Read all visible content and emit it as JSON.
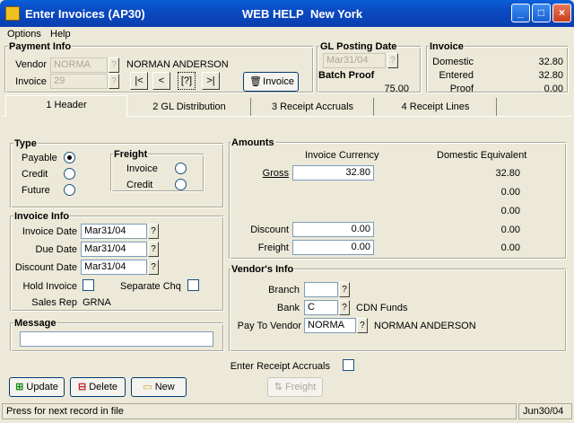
{
  "window": {
    "title": "Enter Invoices (AP30)",
    "web_help": "WEB HELP",
    "company": "New York"
  },
  "menu": [
    "Options",
    "Help"
  ],
  "payment_info": {
    "legend": "Payment Info",
    "vendor_label": "Vendor",
    "vendor_value": "NORMA",
    "vendor_name": "NORMAN ANDERSON",
    "invoice_label": "Invoice",
    "invoice_value": "29",
    "invoice_button": "Invoice",
    "nav": [
      "|<",
      "<",
      "[?]",
      ">|"
    ]
  },
  "gl_posting": {
    "legend": "GL Posting Date",
    "date": "Mar31/04",
    "batch_proof_label": "Batch Proof",
    "batch_proof_value": "75.00"
  },
  "invoice_summary": {
    "legend": "Invoice",
    "domestic_label": "Domestic",
    "domestic_value": "32.80",
    "entered_label": "Entered",
    "entered_value": "32.80",
    "proof_label": "Proof",
    "proof_value": "0.00"
  },
  "tabs": [
    "1 Header",
    "2 GL Distribution",
    "3 Receipt Accruals",
    "4 Receipt Lines"
  ],
  "type": {
    "legend": "Type",
    "options": [
      "Payable",
      "Credit",
      "Future"
    ],
    "selected": "Payable"
  },
  "freight": {
    "legend": "Freight",
    "options": [
      "Invoice",
      "Credit"
    ]
  },
  "invoice_info": {
    "legend": "Invoice Info",
    "invoice_date_label": "Invoice Date",
    "invoice_date": "Mar31/04",
    "due_date_label": "Due Date",
    "due_date": "Mar31/04",
    "discount_date_label": "Discount Date",
    "discount_date": "Mar31/04",
    "hold_invoice_label": "Hold Invoice",
    "separate_chq_label": "Separate Chq",
    "sales_rep_label": "Sales Rep",
    "sales_rep": "GRNA"
  },
  "message": {
    "legend": "Message",
    "value": ""
  },
  "amounts": {
    "legend": "Amounts",
    "col_invoice": "Invoice Currency",
    "col_domestic": "Domestic Equivalent",
    "gross_label": "Gross",
    "gross_value": "32.80",
    "gross_domestic": "32.80",
    "blank_domestic_1": "0.00",
    "blank_domestic_2": "0.00",
    "discount_label": "Discount",
    "discount_value": "0.00",
    "discount_domestic": "0.00",
    "freight_label": "Freight",
    "freight_value": "0.00",
    "freight_domestic": "0.00"
  },
  "vendor_info": {
    "legend": "Vendor's Info",
    "branch_label": "Branch",
    "branch_value": "",
    "bank_label": "Bank",
    "bank_value": "C",
    "bank_desc": "CDN Funds",
    "pay_to_label": "Pay To Vendor",
    "pay_to_value": "NORMA",
    "pay_to_name": "NORMAN ANDERSON"
  },
  "receipt_accruals_label": "Enter Receipt Accruals",
  "buttons": {
    "update": "Update",
    "delete": "Delete",
    "new": "New",
    "freight": "Freight"
  },
  "status": {
    "message": "Press for next record in file",
    "date": "Jun30/04"
  }
}
